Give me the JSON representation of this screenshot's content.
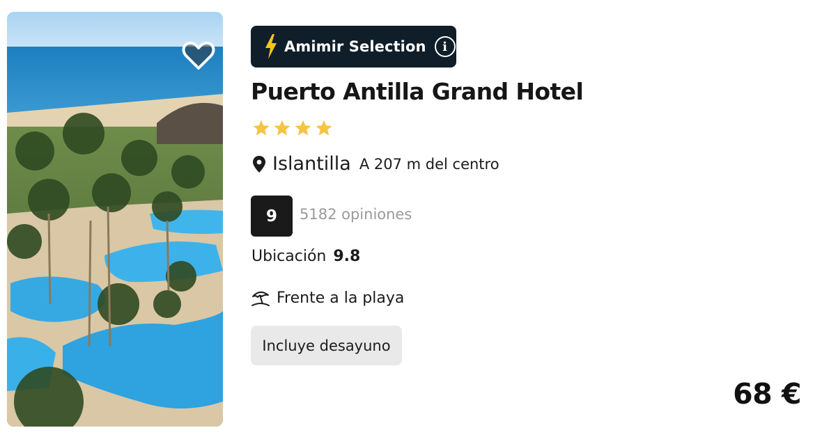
{
  "hotel": {
    "badge_label": "Amimir Selection",
    "badge_info_glyph": "i",
    "name": "Puerto Antilla Grand Hotel",
    "star_rating": 4,
    "location_city": "Islantilla",
    "location_distance": "A 207 m del centro",
    "score": "9",
    "reviews": "5182 opiniones",
    "location_score_label": "Ubicación",
    "location_score": "9.8",
    "feature": "Frente a la playa",
    "tag": "Incluye desayuno",
    "price": "68 €"
  },
  "icons": {
    "favorite": "heart-icon",
    "badge": "lightning-bolt-icon",
    "info": "info-icon",
    "location": "map-pin-icon",
    "feature": "beach-umbrella-icon",
    "star": "star-icon"
  },
  "colors": {
    "badge_bg": "#0f1e29",
    "bolt": "#f5c518",
    "star": "#f6c343",
    "score_bg": "#1a1a1a",
    "tag_bg": "#e9e9e9"
  }
}
